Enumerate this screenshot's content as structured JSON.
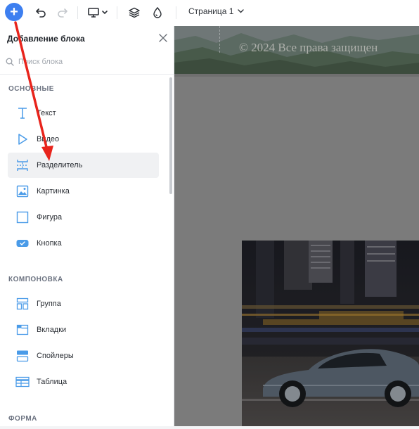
{
  "toolbar": {
    "add_symbol": "+",
    "page_label": "Страница 1"
  },
  "panel": {
    "title": "Добавление блока",
    "search_placeholder": "Поиск блока",
    "sections": [
      {
        "label": "ОСНОВНЫЕ"
      },
      {
        "label": "КОМПОНОВКА"
      },
      {
        "label": "ФОРМА"
      }
    ],
    "items": [
      {
        "label": "Текст",
        "icon": "text-icon"
      },
      {
        "label": "Видео",
        "icon": "play-icon"
      },
      {
        "label": "Разделитель",
        "icon": "divider-icon",
        "active": true
      },
      {
        "label": "Картинка",
        "icon": "image-icon"
      },
      {
        "label": "Фигура",
        "icon": "shape-icon"
      },
      {
        "label": "Кнопка",
        "icon": "button-icon"
      },
      {
        "label": "Группа",
        "icon": "group-icon"
      },
      {
        "label": "Вкладки",
        "icon": "tabs-icon"
      },
      {
        "label": "Спойлеры",
        "icon": "spoiler-icon"
      },
      {
        "label": "Таблица",
        "icon": "table-icon"
      }
    ]
  },
  "canvas": {
    "footer_text": "© 2024 Все права защищен"
  },
  "colors": {
    "accent": "#3d7ff0",
    "icon_blue": "#4a9be8",
    "annotation_red": "#e8241c",
    "canvas_overlay": "#7b7b7b"
  }
}
